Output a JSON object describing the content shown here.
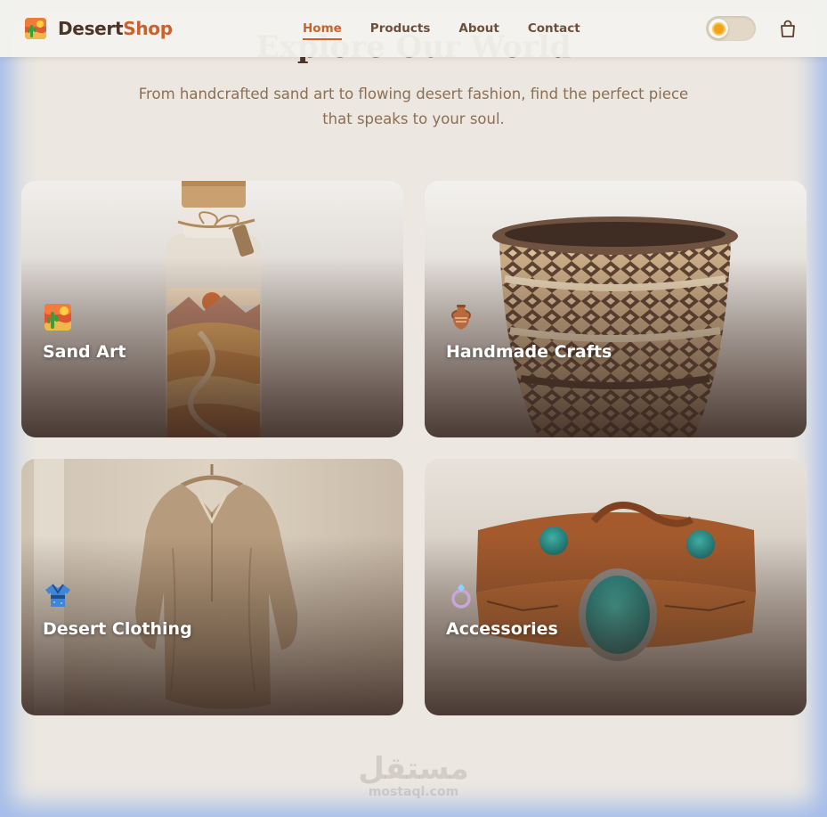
{
  "header": {
    "brand_main": "Desert",
    "brand_accent": "Shop",
    "nav": [
      {
        "label": "Home",
        "active": true
      },
      {
        "label": "Products",
        "active": false
      },
      {
        "label": "About",
        "active": false
      },
      {
        "label": "Contact",
        "active": false
      }
    ],
    "theme_toggle_icon": "sun-icon",
    "cart_icon": "shopping-bag-icon"
  },
  "hero": {
    "title": "Explore Our World",
    "subtitle": "From handcrafted sand art to flowing desert fashion, find the perfect piece that speaks to your soul."
  },
  "categories": [
    {
      "title": "Sand Art",
      "icon": "cactus-desert-icon"
    },
    {
      "title": "Handmade Crafts",
      "icon": "amphora-icon"
    },
    {
      "title": "Desert Clothing",
      "icon": "kimono-icon"
    },
    {
      "title": "Accessories",
      "icon": "ring-icon"
    }
  ],
  "watermark": {
    "arabic": "مستقل",
    "latin": "mostaql.com"
  },
  "colors": {
    "accent": "#c8632e",
    "text_dark": "#4a3528",
    "text_muted": "#8c6f52",
    "background": "#ece8e1"
  }
}
